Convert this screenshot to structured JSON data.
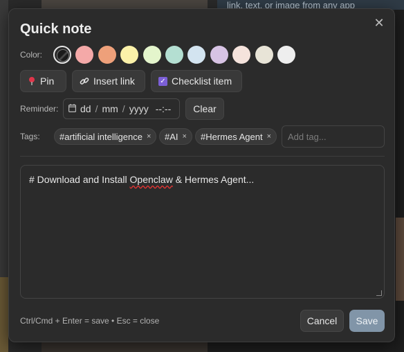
{
  "background": {
    "top_right_text": "link, text, or image from any app"
  },
  "dialog": {
    "title": "Quick note",
    "close_glyph": "✕"
  },
  "color": {
    "label": "Color:",
    "swatches": [
      "#2b2b2b",
      "#f4a9a8",
      "#eea07a",
      "#fbf1a9",
      "#e4f5cc",
      "#b4dfd2",
      "#d3e4f0",
      "#d7c3e4",
      "#f5e3dc",
      "#e8e4d7",
      "#eeeeee"
    ],
    "selected_index": 0
  },
  "toolbar": {
    "pin_label": "Pin",
    "pin_icon": "pushpin-icon",
    "link_label": "Insert link",
    "link_icon": "link-icon",
    "checklist_label": "Checklist item",
    "checklist_icon": "checkbox-icon"
  },
  "reminder": {
    "label": "Reminder:",
    "dd": "dd",
    "mm": "mm",
    "yyyy": "yyyy",
    "time": "--:--",
    "slash": "/",
    "clear_label": "Clear"
  },
  "tags": {
    "label": "Tags:",
    "items": [
      "#artificial intelligence",
      "#AI",
      "#Hermes Agent"
    ],
    "remove_glyph": "×",
    "input_placeholder": "Add tag..."
  },
  "note": {
    "text_before": "# Download and Install ",
    "text_misspelled": "Openclaw",
    "text_after": " & Hermes Agent..."
  },
  "footer": {
    "hint": "Ctrl/Cmd + Enter = save • Esc = close",
    "cancel_label": "Cancel",
    "save_label": "Save"
  },
  "colors": {
    "dialog_bg": "#2b2b2b",
    "save_bg": "#8195a8",
    "check_accent": "#7b5fd6"
  }
}
